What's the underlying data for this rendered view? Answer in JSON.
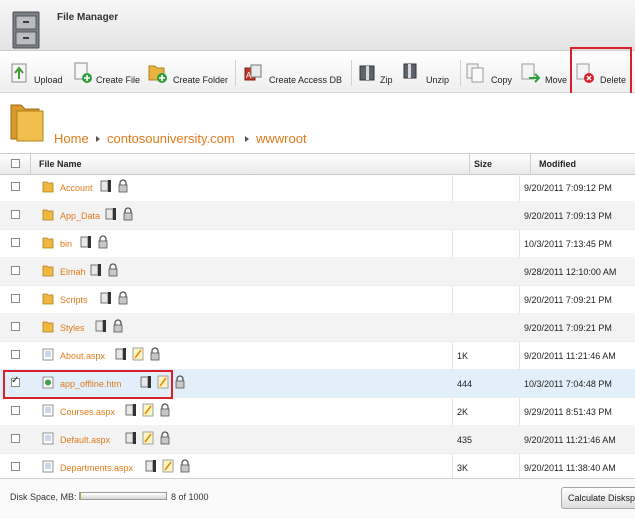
{
  "app": {
    "title": "File Manager",
    "icon": "filing-cabinet-icon"
  },
  "toolbar": {
    "buttons": [
      {
        "label": "Upload",
        "icon": "upload-icon"
      },
      {
        "label": "Create File",
        "icon": "new-file-icon"
      },
      {
        "label": "Create Folder",
        "icon": "new-folder-icon"
      },
      {
        "label": "Create Access DB",
        "icon": "database-icon"
      },
      {
        "label": "Zip",
        "icon": "zip-icon"
      },
      {
        "label": "Unzip",
        "icon": "unzip-icon"
      },
      {
        "label": "Copy",
        "icon": "copy-icon"
      },
      {
        "label": "Move",
        "icon": "move-icon"
      },
      {
        "label": "Delete",
        "icon": "delete-icon"
      }
    ]
  },
  "breadcrumb": {
    "items": [
      "Home",
      "contosouniversity.com",
      "wwwroot"
    ]
  },
  "grid": {
    "columns": {
      "name": "File Name",
      "size": "Size",
      "modified": "Modified"
    },
    "rows": [
      {
        "name": "Account",
        "type": "folder",
        "size": "",
        "modified": "9/20/2011 7:09:12 PM",
        "checked": false
      },
      {
        "name": "App_Data",
        "type": "folder",
        "size": "",
        "modified": "9/20/2011 7:09:13 PM",
        "checked": false
      },
      {
        "name": "bin",
        "type": "folder",
        "size": "",
        "modified": "10/3/2011 7:13:45 PM",
        "checked": false
      },
      {
        "name": "Elmah",
        "type": "folder",
        "size": "",
        "modified": "9/28/2011 12:10:00 AM",
        "checked": false
      },
      {
        "name": "Scripts",
        "type": "folder",
        "size": "",
        "modified": "9/20/2011 7:09:21 PM",
        "checked": false
      },
      {
        "name": "Styles",
        "type": "folder",
        "size": "",
        "modified": "9/20/2011 7:09:21 PM",
        "checked": false
      },
      {
        "name": "About.aspx",
        "type": "file",
        "size": "1K",
        "modified": "9/20/2011 11:21:46 AM",
        "checked": false
      },
      {
        "name": "app_offline.htm",
        "type": "htm",
        "size": "444",
        "modified": "10/3/2011 7:04:48 PM",
        "checked": true
      },
      {
        "name": "Courses.aspx",
        "type": "file",
        "size": "2K",
        "modified": "9/29/2011 8:51:43 PM",
        "checked": false
      },
      {
        "name": "Default.aspx",
        "type": "file",
        "size": "435",
        "modified": "9/20/2011 11:21:46 AM",
        "checked": false
      },
      {
        "name": "Departments.aspx",
        "type": "file",
        "size": "3K",
        "modified": "9/20/2011 11:38:40 AM",
        "checked": false
      }
    ]
  },
  "footer": {
    "disk_label": "Disk Space, MB:",
    "disk_used": 8,
    "disk_total": 1000,
    "disk_text": "8 of 1000",
    "calculate_label": "Calculate Diskspace"
  },
  "colors": {
    "link": "#e07b1a",
    "highlight": "#d9202a",
    "selected_row": "#e2eefa"
  }
}
